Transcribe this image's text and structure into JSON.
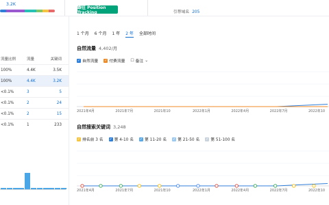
{
  "top": {
    "link_number": "3.2K",
    "position_tracking_button": "跟往 Position Tracking",
    "ref_domains_label": "引荐域名",
    "ref_domains_value": "205",
    "colorbar": [
      "#2f7ed8",
      "#9b59d0",
      "#27c1b5",
      "#86c665",
      "#f4c542",
      "#e86b6b"
    ]
  },
  "left_table": {
    "headers": [
      "流量比例",
      "流量",
      "关键词"
    ],
    "rows": [
      {
        "share": "100%",
        "traffic": "4.4K",
        "keywords": "3.5K",
        "selected": false,
        "link": false
      },
      {
        "share": "100%",
        "traffic": "4.4K",
        "keywords": "3.2K",
        "selected": true,
        "link": true
      },
      {
        "share": "<0.1%",
        "traffic": "3",
        "keywords": "5",
        "selected": false,
        "link": true
      },
      {
        "share": "<0.1%",
        "traffic": "2",
        "keywords": "24",
        "selected": false,
        "link": true
      },
      {
        "share": "<0.1%",
        "traffic": "2",
        "keywords": "15",
        "selected": false,
        "link": true
      },
      {
        "share": "<0.1%",
        "traffic": "1",
        "keywords": "233",
        "selected": false,
        "link": false
      }
    ],
    "mini_chart_values": [
      1,
      1,
      1,
      1,
      12,
      1,
      1,
      1,
      1,
      1,
      1
    ],
    "mini_icons": [
      "⊕",
      "⊙",
      "☆",
      "▣",
      "◎",
      "⊙"
    ]
  },
  "time_tabs": [
    "1 个月",
    "6 个月",
    "1 年",
    "2 年",
    "全部时间"
  ],
  "active_time_tab": "2 年",
  "organic_traffic": {
    "title": "自然流量",
    "value": "4,402/月",
    "legend": [
      {
        "label": "自然流量",
        "color": "#2f7ed8",
        "checked": true
      },
      {
        "label": "付费流量",
        "color": "#f08a24",
        "checked": true
      }
    ],
    "note_label": "备注"
  },
  "organic_keywords": {
    "title": "自然搜索关键词",
    "value": "3,248",
    "legend": [
      {
        "label": "排名前 3 名",
        "color": "#f4c542",
        "checked": true
      },
      {
        "label": "第 4-10 名",
        "color": "#2f7ed8",
        "checked": true
      },
      {
        "label": "第 11-20 名",
        "color": "#5aa9e6",
        "checked": true
      },
      {
        "label": "第 21-50 名",
        "color": "#9cc9ef",
        "checked": true
      },
      {
        "label": "第 51-100 名",
        "color": "#c9d3dc",
        "checked": true
      }
    ]
  },
  "chart_data": [
    {
      "type": "line",
      "title": "自然流量",
      "x": [
        "2021年4月",
        "2021年7月",
        "2021年10",
        "2022年1月",
        "2022年4月",
        "2022年7月",
        "2022年10"
      ],
      "series": [
        {
          "name": "自然流量",
          "values": [
            0,
            0,
            0,
            0,
            0,
            0,
            4402
          ]
        },
        {
          "name": "付费流量",
          "values": [
            0,
            0,
            0,
            0,
            0,
            0,
            0
          ]
        }
      ],
      "xlabel": "",
      "ylabel": "",
      "grid": true
    },
    {
      "type": "area",
      "title": "自然搜索关键词",
      "x": [
        "2021年4月",
        "2021年7月",
        "2021年10",
        "2022年1月",
        "2022年4月",
        "2022年7月",
        "2022年10"
      ],
      "series": [
        {
          "name": "第 4-10 名",
          "values": [
            0,
            0,
            0,
            0,
            0,
            0,
            3248
          ]
        }
      ],
      "xlabel": "",
      "ylabel": "",
      "grid": true
    }
  ]
}
